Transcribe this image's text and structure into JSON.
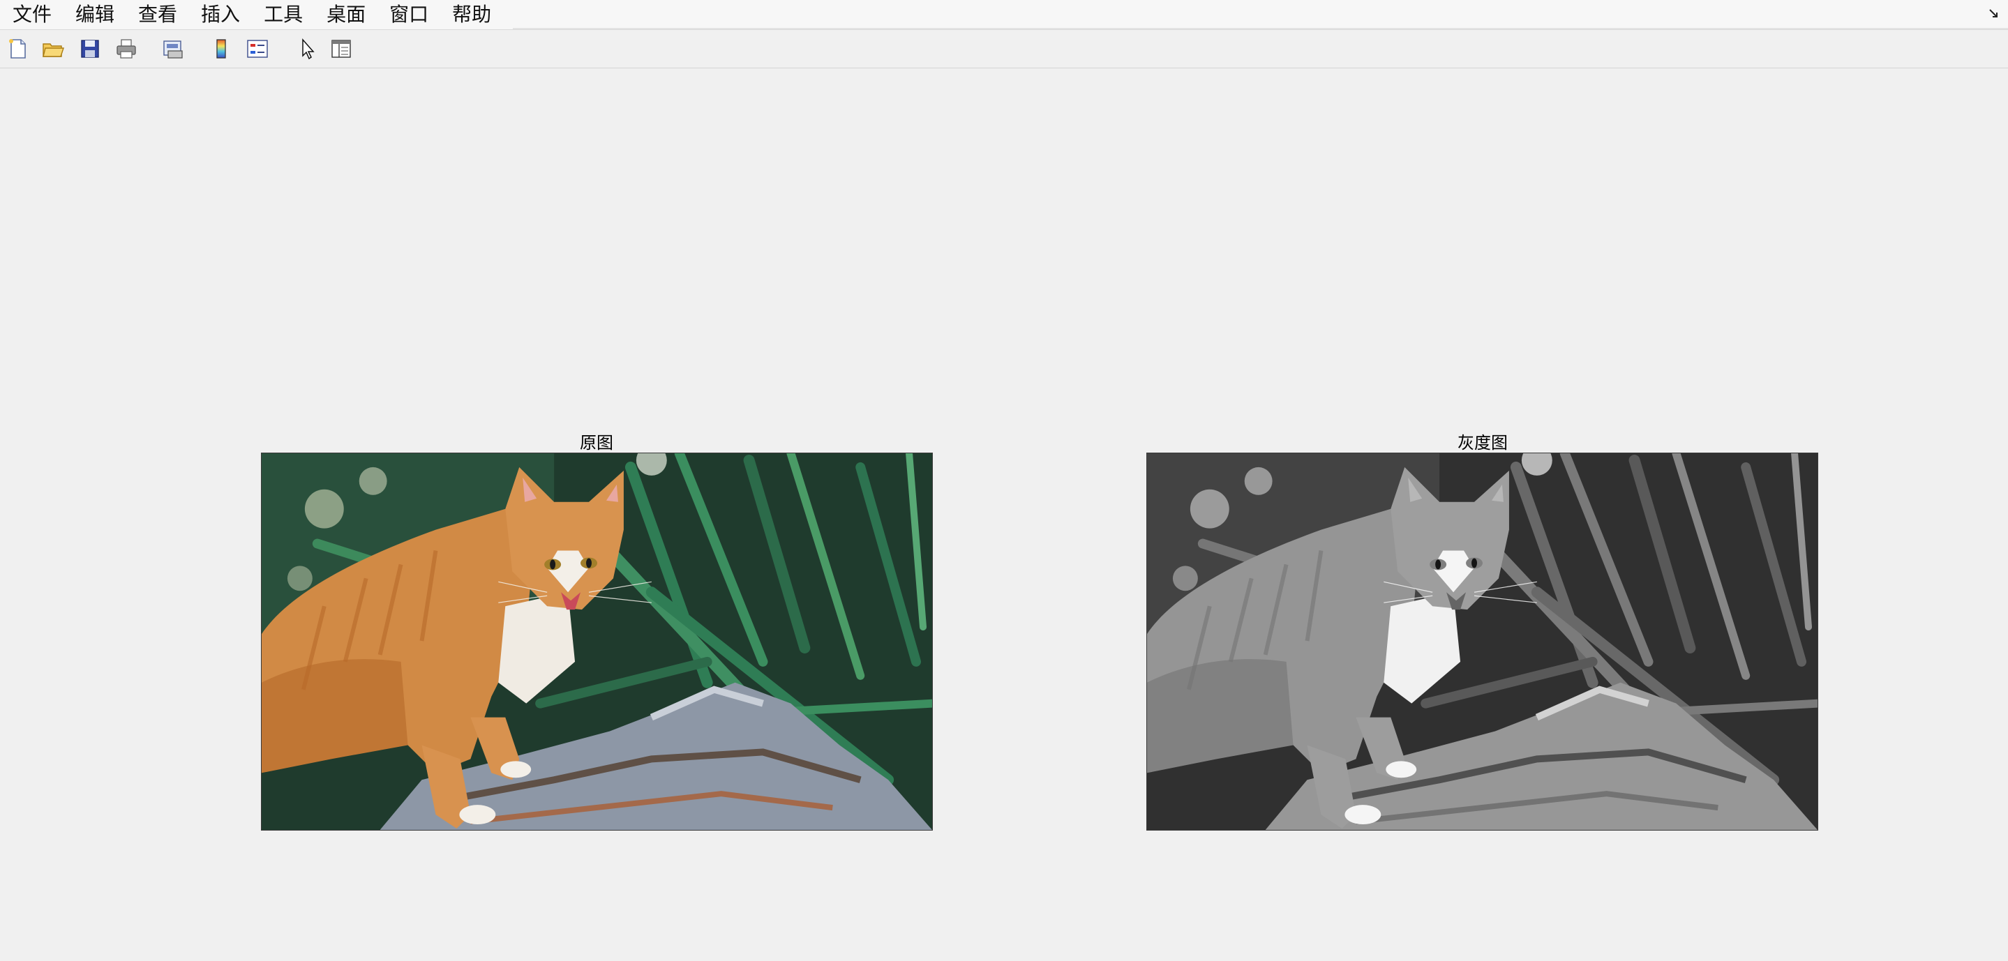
{
  "menubar": {
    "items": [
      {
        "label": "文件"
      },
      {
        "label": "编辑"
      },
      {
        "label": "查看"
      },
      {
        "label": "插入"
      },
      {
        "label": "工具"
      },
      {
        "label": "桌面"
      },
      {
        "label": "窗口"
      },
      {
        "label": "帮助"
      }
    ]
  },
  "toolbar": {
    "buttons": [
      {
        "icon": "new-figure-icon"
      },
      {
        "icon": "open-file-icon"
      },
      {
        "icon": "save-icon"
      },
      {
        "icon": "print-icon"
      },
      {
        "icon": "print-preview-icon"
      },
      {
        "icon": "colorbar-icon"
      },
      {
        "icon": "legend-icon"
      },
      {
        "icon": "select-pointer-icon"
      },
      {
        "icon": "property-editor-icon"
      }
    ]
  },
  "figures": [
    {
      "title": "原图",
      "image": "orange-tabby-cat-on-rock-color"
    },
    {
      "title": "灰度图",
      "image": "orange-tabby-cat-on-rock-grayscale"
    }
  ],
  "colors": {
    "background": "#f0f0f0",
    "menubar": "#f7f7f7"
  }
}
